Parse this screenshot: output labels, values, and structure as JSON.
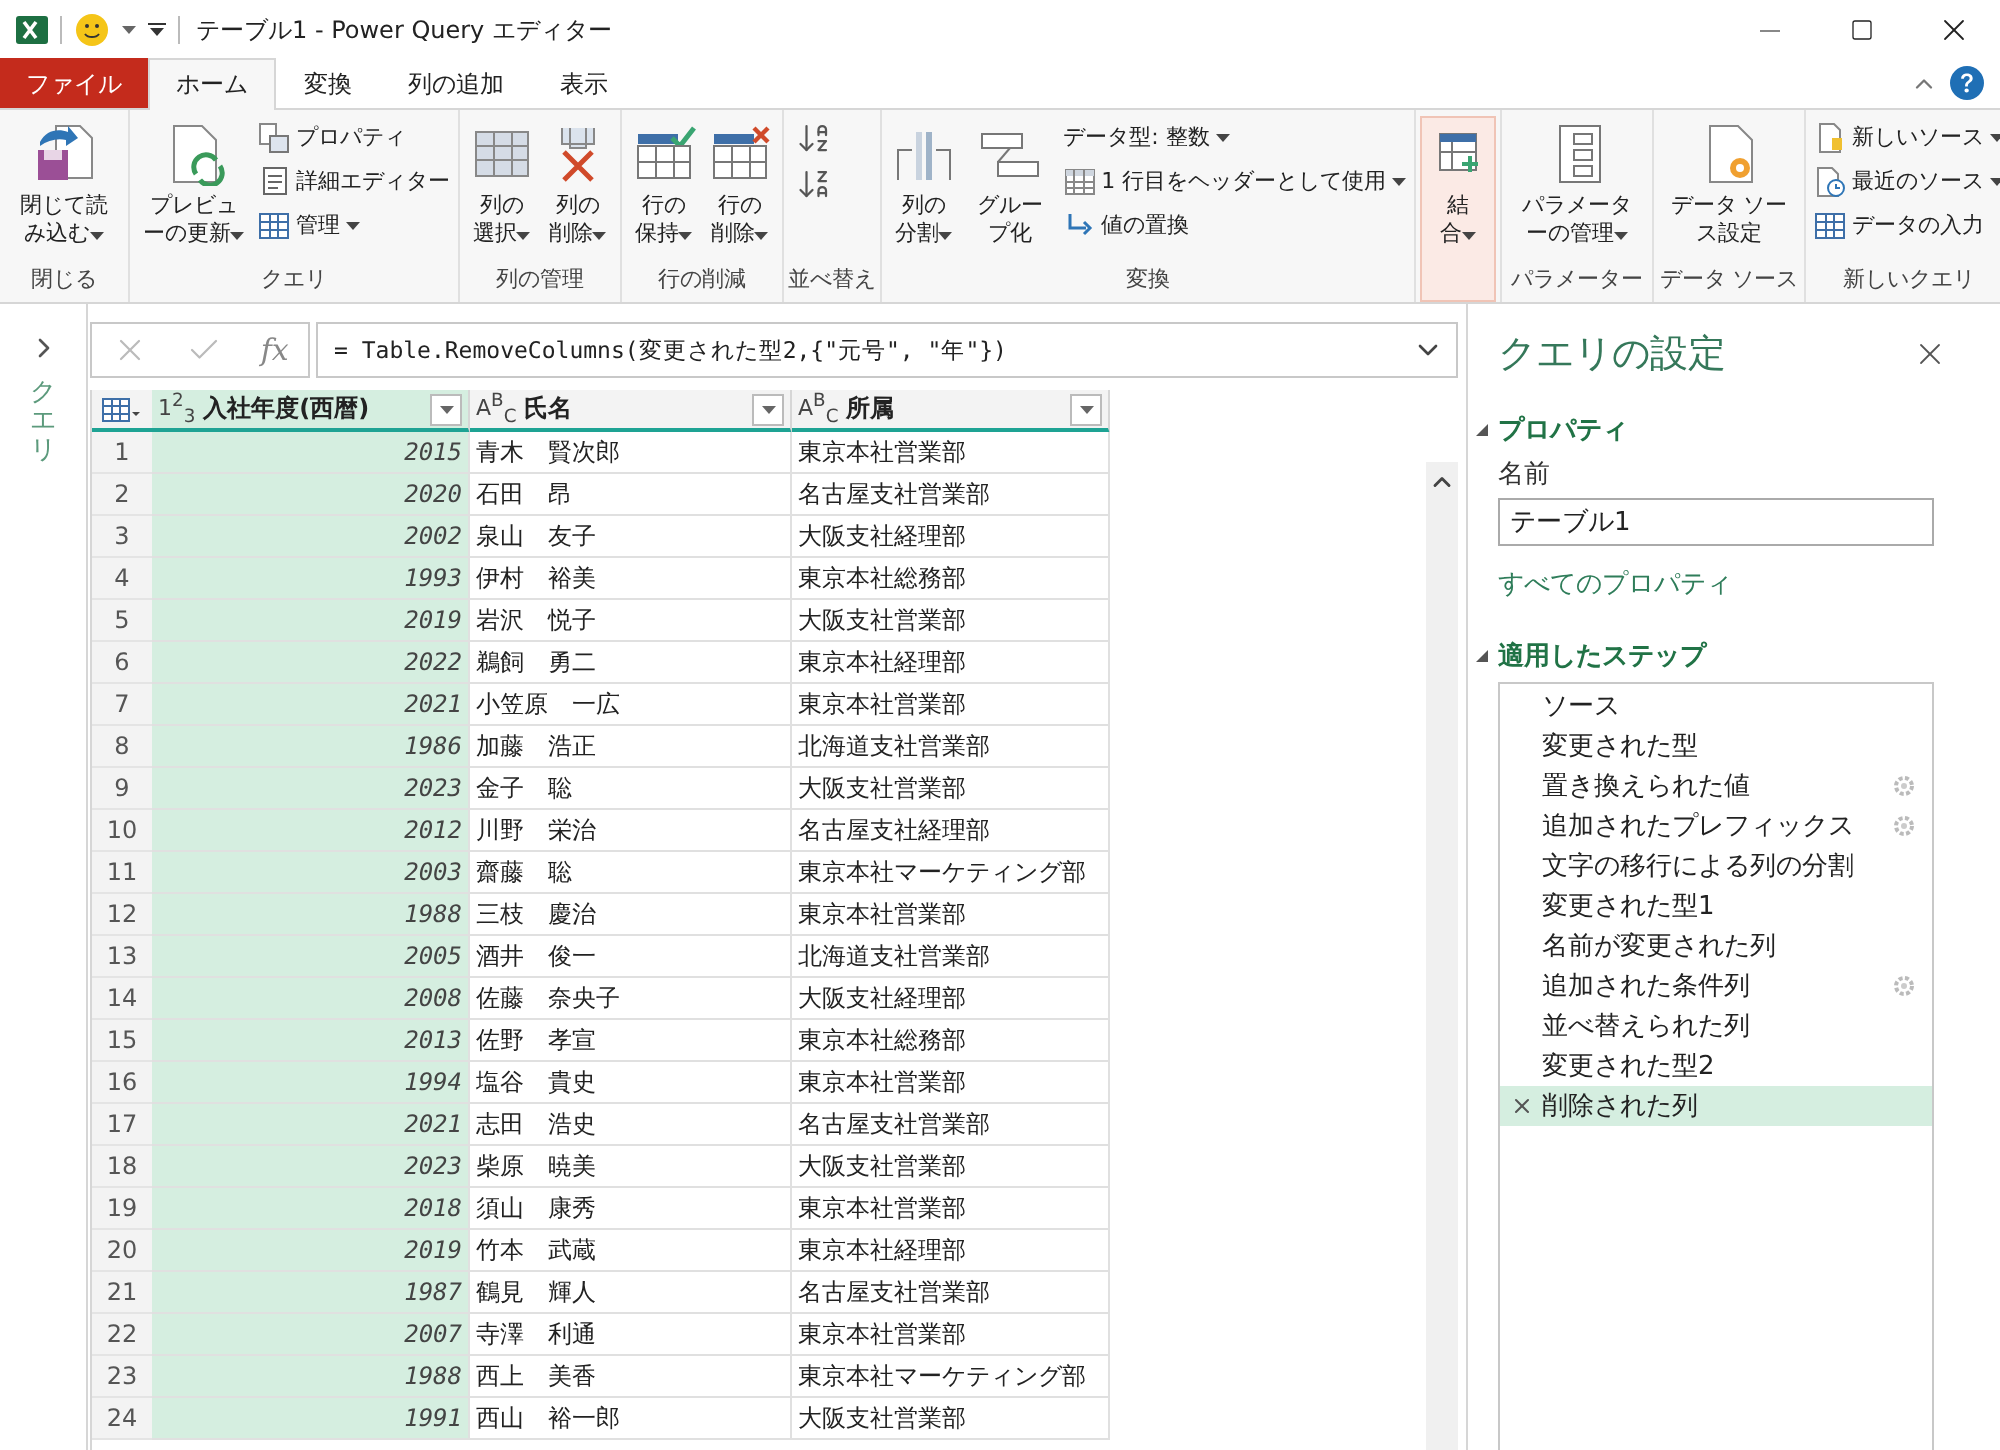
{
  "window": {
    "title": "テーブル1 - Power Query エディター"
  },
  "ribbon_tabs": [
    {
      "label": "ファイル",
      "kind": "file",
      "selected": false
    },
    {
      "label": "ホーム",
      "kind": "tab",
      "selected": true
    },
    {
      "label": "変換",
      "kind": "tab",
      "selected": false
    },
    {
      "label": "列の追加",
      "kind": "tab",
      "selected": false
    },
    {
      "label": "表示",
      "kind": "tab",
      "selected": false
    }
  ],
  "ribbon_groups": [
    {
      "label": "閉じる",
      "items": [
        {
          "kind": "large",
          "label": "閉じて読み込む",
          "dropdown": true
        }
      ]
    },
    {
      "label": "クエリ",
      "items": [
        {
          "kind": "large",
          "label": "プレビューの更新",
          "dropdown": true
        },
        {
          "kind": "small",
          "label": "プロパティ",
          "dropdown": false
        },
        {
          "kind": "small",
          "label": "詳細エディター",
          "dropdown": false
        },
        {
          "kind": "small",
          "label": "管理",
          "dropdown": true
        }
      ]
    },
    {
      "label": "列の管理",
      "items": [
        {
          "kind": "large",
          "label": "列の選択",
          "dropdown": true
        },
        {
          "kind": "large",
          "label": "列の削除",
          "dropdown": true
        }
      ]
    },
    {
      "label": "行の削減",
      "items": [
        {
          "kind": "large",
          "label": "行の保持",
          "dropdown": true
        },
        {
          "kind": "large",
          "label": "行の削除",
          "dropdown": true
        }
      ]
    },
    {
      "label": "並べ替え",
      "items": [
        {
          "kind": "icon"
        },
        {
          "kind": "icon"
        }
      ]
    },
    {
      "label": "変換",
      "items": [
        {
          "kind": "large",
          "label": "列の分割",
          "dropdown": true
        },
        {
          "kind": "large",
          "label": "グループ化",
          "dropdown": false
        },
        {
          "kind": "small",
          "label": "データ型: 整数",
          "dropdown": true
        },
        {
          "kind": "small",
          "label": "1 行目をヘッダーとして使用",
          "dropdown": true
        },
        {
          "kind": "small",
          "label": "値の置換",
          "dropdown": false
        }
      ]
    },
    {
      "items": [
        {
          "kind": "large",
          "label": "結合",
          "dropdown": true,
          "highlighted": true
        }
      ]
    },
    {
      "label": "パラメーター",
      "items": [
        {
          "kind": "large",
          "label": "パラメーターの管理",
          "dropdown": true
        }
      ]
    },
    {
      "label": "データ ソース",
      "items": [
        {
          "kind": "large",
          "label": "データ ソース設定",
          "dropdown": false
        }
      ]
    },
    {
      "label": "新しいクエリ",
      "items": [
        {
          "kind": "small",
          "label": "新しいソース",
          "dropdown": true
        },
        {
          "kind": "small",
          "label": "最近のソース",
          "dropdown": true
        },
        {
          "kind": "small",
          "label": "データの入力",
          "dropdown": false
        }
      ]
    }
  ],
  "navigator": {
    "label": "クエリ"
  },
  "formula_bar": {
    "fx_label": "fx",
    "formula": "= Table.RemoveColumns(変更された型2,{\"元号\", \"年\"})"
  },
  "table": {
    "columns": [
      {
        "type_label": "1$^{2}$$_{3}$",
        "name": "入社年度(西暦)",
        "selected": true
      },
      {
        "type_label": "A$^{B}$$_{C}$",
        "name": "氏名",
        "selected": false
      },
      {
        "type_label": "A$^{B}$$_{C}$",
        "name": "所属",
        "selected": false
      }
    ],
    "rows": [
      {
        "num": "1",
        "cells": [
          "2015",
          "青木　賢次郎",
          "東京本社営業部"
        ]
      },
      {
        "num": "2",
        "cells": [
          "2020",
          "石田　昂",
          "名古屋支社営業部"
        ]
      },
      {
        "num": "3",
        "cells": [
          "2002",
          "泉山　友子",
          "大阪支社経理部"
        ]
      },
      {
        "num": "4",
        "cells": [
          "1993",
          "伊村　裕美",
          "東京本社総務部"
        ]
      },
      {
        "num": "5",
        "cells": [
          "2019",
          "岩沢　悦子",
          "大阪支社営業部"
        ]
      },
      {
        "num": "6",
        "cells": [
          "2022",
          "鵜飼　勇二",
          "東京本社経理部"
        ]
      },
      {
        "num": "7",
        "cells": [
          "2021",
          "小笠原　一広",
          "東京本社営業部"
        ]
      },
      {
        "num": "8",
        "cells": [
          "1986",
          "加藤　浩正",
          "北海道支社営業部"
        ]
      },
      {
        "num": "9",
        "cells": [
          "2023",
          "金子　聡",
          "大阪支社営業部"
        ]
      },
      {
        "num": "10",
        "cells": [
          "2012",
          "川野　栄治",
          "名古屋支社経理部"
        ]
      },
      {
        "num": "11",
        "cells": [
          "2003",
          "齋藤　聡",
          "東京本社マーケティング部"
        ]
      },
      {
        "num": "12",
        "cells": [
          "1988",
          "三枝　慶治",
          "東京本社営業部"
        ]
      },
      {
        "num": "13",
        "cells": [
          "2005",
          "酒井　俊一",
          "北海道支社営業部"
        ]
      },
      {
        "num": "14",
        "cells": [
          "2008",
          "佐藤　奈央子",
          "大阪支社経理部"
        ]
      },
      {
        "num": "15",
        "cells": [
          "2013",
          "佐野　孝宣",
          "東京本社総務部"
        ]
      },
      {
        "num": "16",
        "cells": [
          "1994",
          "塩谷　貴史",
          "東京本社営業部"
        ]
      },
      {
        "num": "17",
        "cells": [
          "2021",
          "志田　浩史",
          "名古屋支社営業部"
        ]
      },
      {
        "num": "18",
        "cells": [
          "2023",
          "柴原　暁美",
          "大阪支社営業部"
        ]
      },
      {
        "num": "19",
        "cells": [
          "2018",
          "須山　康秀",
          "東京本社営業部"
        ]
      },
      {
        "num": "20",
        "cells": [
          "2019",
          "竹本　武蔵",
          "東京本社経理部"
        ]
      },
      {
        "num": "21",
        "cells": [
          "1987",
          "鶴見　輝人",
          "名古屋支社営業部"
        ]
      },
      {
        "num": "22",
        "cells": [
          "2007",
          "寺澤　利通",
          "東京本社営業部"
        ]
      },
      {
        "num": "23",
        "cells": [
          "1988",
          "西上　美香",
          "東京本社マーケティング部"
        ]
      },
      {
        "num": "24",
        "cells": [
          "1991",
          "西山　裕一郎",
          "大阪支社営業部"
        ]
      }
    ]
  },
  "query_settings": {
    "title": "クエリの設定",
    "properties_heading": "プロパティ",
    "name_label": "名前",
    "name_value": "テーブル1",
    "all_properties_link": "すべてのプロパティ",
    "steps_heading": "適用したステップ",
    "steps": [
      {
        "label": "ソース",
        "settings": false,
        "selected": false
      },
      {
        "label": "変更された型",
        "settings": false,
        "selected": false
      },
      {
        "label": "置き換えられた値",
        "settings": true,
        "selected": false
      },
      {
        "label": "追加されたプレフィックス",
        "settings": true,
        "selected": false
      },
      {
        "label": "文字の移行による列の分割",
        "settings": false,
        "selected": false
      },
      {
        "label": "変更された型1",
        "settings": false,
        "selected": false
      },
      {
        "label": "名前が変更された列",
        "settings": false,
        "selected": false
      },
      {
        "label": "追加された条件列",
        "settings": true,
        "selected": false
      },
      {
        "label": "並べ替えられた列",
        "settings": false,
        "selected": false
      },
      {
        "label": "変更された型2",
        "settings": false,
        "selected": false
      },
      {
        "label": "削除された列",
        "settings": false,
        "selected": true
      }
    ]
  }
}
